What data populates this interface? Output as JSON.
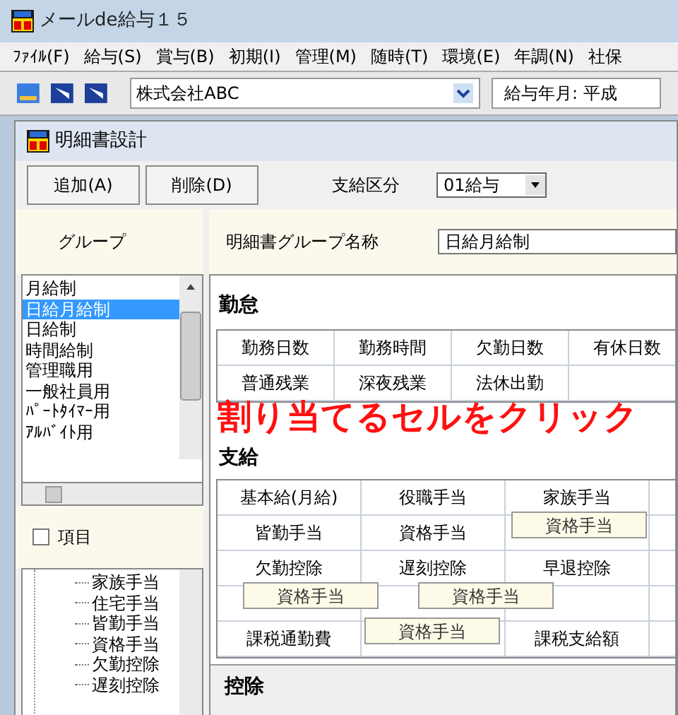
{
  "window": {
    "title": "メールde給与１５"
  },
  "menu": [
    "ﾌｧｲﾙ(F)",
    "給与(S)",
    "賞与(B)",
    "初期(I)",
    "管理(M)",
    "随時(T)",
    "環境(E)",
    "年調(N)",
    "社保"
  ],
  "toolbar": {
    "company": "株式会社ABC",
    "period": "給与年月: 平成"
  },
  "dialog": {
    "title": "明細書設計",
    "buttons": [
      "追加(A)",
      "削除(D)"
    ],
    "category": {
      "label": "支給区分",
      "value": "01給与"
    },
    "group_header": "グループ",
    "groups": [
      {
        "label": "月給制",
        "selected": false
      },
      {
        "label": "日給月給制",
        "selected": true
      },
      {
        "label": "日給制",
        "selected": false
      },
      {
        "label": "時間給制",
        "selected": false
      },
      {
        "label": "管理職用",
        "selected": false
      },
      {
        "label": "一般社員用",
        "selected": false
      },
      {
        "label": "ﾊﾟｰﾄﾀｲﾏｰ用",
        "selected": false
      },
      {
        "label": "ｱﾙﾊﾞｲﾄ用",
        "selected": false
      }
    ],
    "items_toggle": {
      "label": "項目",
      "checked": false
    },
    "items": [
      "家族手当",
      "住宅手当",
      "皆勤手当",
      "資格手当",
      "欠勤控除",
      "遅刻控除"
    ],
    "group_name": {
      "label": "明細書グループ名称",
      "value": "日給月給制"
    },
    "sections": [
      {
        "title": "勤怠",
        "rows": [
          [
            "勤務日数",
            "勤務時間",
            "欠勤日数",
            "有休日数"
          ],
          [
            "普通残業",
            "深夜残業",
            "法休出勤",
            ""
          ]
        ]
      },
      {
        "title": "支給",
        "rows": [
          [
            "基本給(月給)",
            "役職手当",
            "家族手当",
            ""
          ],
          [
            "皆勤手当",
            "資格手当",
            "",
            ""
          ],
          [
            "欠勤控除",
            "遅刻控除",
            "早退控除",
            ""
          ],
          [
            "",
            "",
            "",
            ""
          ],
          [
            "課税通勤費",
            "",
            "課税支給額",
            ""
          ]
        ]
      },
      {
        "title": "控除"
      }
    ]
  },
  "annotation": "割り当てるセルをクリック",
  "drag_ghosts": [
    "資格手当",
    "資格手当",
    "資格手当",
    "資格手当"
  ]
}
